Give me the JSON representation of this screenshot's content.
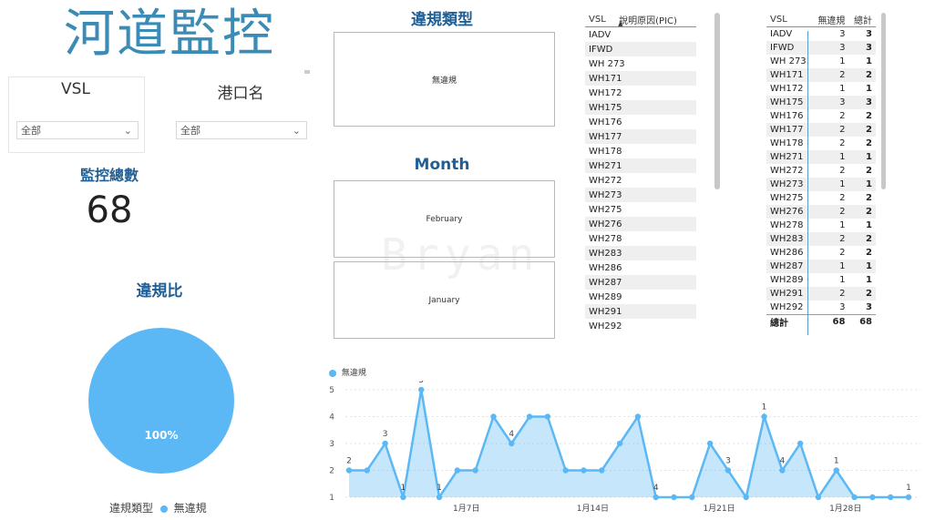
{
  "header": {
    "title": "河道監控"
  },
  "slicers": {
    "vsl": {
      "label": "VSL",
      "value": "全部"
    },
    "port": {
      "label": "港口名",
      "value": "全部"
    }
  },
  "kpi": {
    "label": "監控總數",
    "value": "68"
  },
  "violation_type": {
    "title": "違規類型",
    "card_value": "無違規"
  },
  "month": {
    "title": "Month",
    "items": [
      "February",
      "January"
    ]
  },
  "watermark": "Bryan",
  "ratio": {
    "title": "違規比",
    "pie_label": "100%",
    "legend_title": "違規類型",
    "legend_item": "無違規",
    "color": "#5cb8f5"
  },
  "table1": {
    "headers": [
      "VSL",
      "說明原因(PIC)"
    ],
    "rows": [
      "IADV",
      "IFWD",
      "WH 273",
      "WH171",
      "WH172",
      "WH175",
      "WH176",
      "WH177",
      "WH178",
      "WH271",
      "WH272",
      "WH273",
      "WH275",
      "WH276",
      "WH278",
      "WH283",
      "WH286",
      "WH287",
      "WH289",
      "WH291",
      "WH292"
    ]
  },
  "table2": {
    "headers": [
      "VSL",
      "無違規",
      "總計"
    ],
    "rows": [
      [
        "IADV",
        "3",
        "3"
      ],
      [
        "IFWD",
        "3",
        "3"
      ],
      [
        "WH 273",
        "1",
        "1"
      ],
      [
        "WH171",
        "2",
        "2"
      ],
      [
        "WH172",
        "1",
        "1"
      ],
      [
        "WH175",
        "3",
        "3"
      ],
      [
        "WH176",
        "2",
        "2"
      ],
      [
        "WH177",
        "2",
        "2"
      ],
      [
        "WH178",
        "2",
        "2"
      ],
      [
        "WH271",
        "1",
        "1"
      ],
      [
        "WH272",
        "2",
        "2"
      ],
      [
        "WH273",
        "1",
        "1"
      ],
      [
        "WH275",
        "2",
        "2"
      ],
      [
        "WH276",
        "2",
        "2"
      ],
      [
        "WH278",
        "1",
        "1"
      ],
      [
        "WH283",
        "2",
        "2"
      ],
      [
        "WH286",
        "2",
        "2"
      ],
      [
        "WH287",
        "1",
        "1"
      ],
      [
        "WH289",
        "1",
        "1"
      ],
      [
        "WH291",
        "2",
        "2"
      ],
      [
        "WH292",
        "3",
        "3"
      ]
    ],
    "total": [
      "總計",
      "68",
      "68"
    ]
  },
  "chart_data": {
    "type": "area",
    "series": [
      {
        "name": "無違規",
        "values": [
          2,
          2,
          3,
          1,
          5,
          1,
          2,
          2,
          4,
          3,
          4,
          4,
          2,
          2,
          2,
          3,
          4,
          1,
          1,
          1,
          3,
          2,
          1,
          4,
          2,
          3,
          1,
          2,
          1,
          1,
          1,
          1
        ]
      }
    ],
    "x": [
      1,
      2,
      3,
      4,
      5,
      6,
      7,
      8,
      9,
      10,
      11,
      12,
      13,
      14,
      15,
      16,
      17,
      18,
      19,
      20,
      21,
      22,
      23,
      24,
      25,
      26,
      27,
      28,
      29,
      30,
      31,
      32
    ],
    "xtick_labels": [
      "1月7日",
      "1月14日",
      "1月21日",
      "1月28日"
    ],
    "xtick_positions": [
      7,
      14,
      21,
      28
    ],
    "yticks": [
      "1",
      "2",
      "3",
      "4",
      "5"
    ],
    "ylim": [
      1,
      5
    ],
    "data_labels": [
      {
        "i": 0,
        "text": "2"
      },
      {
        "i": 2,
        "text": "3"
      },
      {
        "i": 3,
        "text": "1"
      },
      {
        "i": 4,
        "text": "5"
      },
      {
        "i": 5,
        "text": "1"
      },
      {
        "i": 9,
        "text": "4"
      },
      {
        "i": 17,
        "text": "4"
      },
      {
        "i": 21,
        "text": "3"
      },
      {
        "i": 23,
        "text": "1"
      },
      {
        "i": 24,
        "text": "4"
      },
      {
        "i": 27,
        "text": "1"
      },
      {
        "i": 33,
        "text": "1"
      }
    ],
    "color": "#5cb8f5"
  }
}
